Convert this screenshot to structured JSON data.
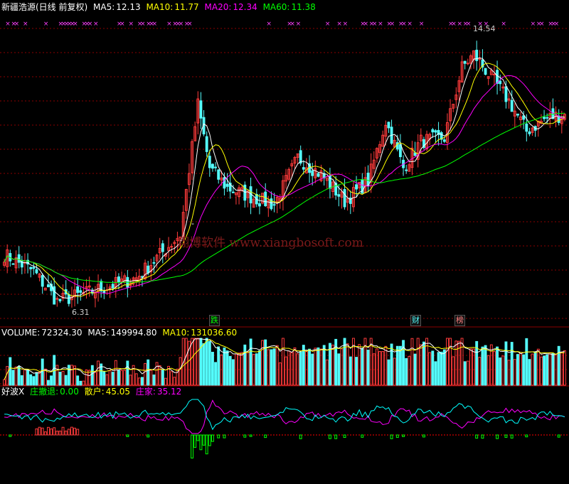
{
  "header": {
    "title": "新疆浩源(日线 前复权)",
    "ma5": {
      "label": "MA5:",
      "value": "12.13"
    },
    "ma10": {
      "label": "MA10:",
      "value": "11.77"
    },
    "ma20": {
      "label": "MA20:",
      "value": "12.34"
    },
    "ma60": {
      "label": "MA60:",
      "value": "11.38"
    }
  },
  "volume_header": {
    "volume": {
      "label": "VOLUME:",
      "value": "72324.30"
    },
    "ma5": {
      "label": "MA5:",
      "value": "149994.80"
    },
    "ma10": {
      "label": "MA10:",
      "value": "131036.60"
    }
  },
  "indicator_header": {
    "name": "好波X",
    "zhuang_withdraw": {
      "label": "庄撤退:",
      "value": "0.00"
    },
    "retail": {
      "label": "散户:",
      "value": "45.05"
    },
    "dealer": {
      "label": "庄家:",
      "value": "35.12"
    }
  },
  "annotations": {
    "high": "14.54",
    "low": "6.31",
    "dash": "-",
    "event_fall": "跌",
    "event_finance": "财",
    "event_list": "榜",
    "watermark": "翔博软件 www.xiangbosoft.com"
  },
  "colors": {
    "up": "#ff3b3b",
    "down": "#54fcfc",
    "ma5": "#ffffff",
    "ma10": "#ffff00",
    "ma20": "#ff00ff",
    "ma60": "#00ff00",
    "grid": "#8b0000",
    "marker": "#ff40ff",
    "retail": "#ff00ff",
    "dealer": "#00ffff",
    "withdraw": "#00ff00"
  },
  "chart_data": {
    "type": "candlestick",
    "symbol": "新疆浩源",
    "period": "daily",
    "price_range": [
      6.0,
      15.2
    ],
    "high_label": 14.54,
    "low_label": 6.31,
    "close_keypoints": [
      {
        "i": 0,
        "c": 8.0
      },
      {
        "i": 10,
        "c": 7.5
      },
      {
        "i": 18,
        "c": 6.6
      },
      {
        "i": 30,
        "c": 6.9
      },
      {
        "i": 45,
        "c": 7.3
      },
      {
        "i": 60,
        "c": 8.6
      },
      {
        "i": 66,
        "c": 12.5
      },
      {
        "i": 70,
        "c": 10.6
      },
      {
        "i": 76,
        "c": 10.0
      },
      {
        "i": 85,
        "c": 9.7
      },
      {
        "i": 92,
        "c": 9.5
      },
      {
        "i": 100,
        "c": 10.9
      },
      {
        "i": 108,
        "c": 10.4
      },
      {
        "i": 116,
        "c": 9.6
      },
      {
        "i": 124,
        "c": 10.2
      },
      {
        "i": 130,
        "c": 12.0
      },
      {
        "i": 136,
        "c": 10.6
      },
      {
        "i": 142,
        "c": 11.4
      },
      {
        "i": 150,
        "c": 11.5
      },
      {
        "i": 156,
        "c": 13.6
      },
      {
        "i": 160,
        "c": 14.0
      },
      {
        "i": 166,
        "c": 13.3
      },
      {
        "i": 172,
        "c": 12.6
      },
      {
        "i": 178,
        "c": 11.7
      },
      {
        "i": 185,
        "c": 12.1
      },
      {
        "i": 191,
        "c": 12.2
      }
    ],
    "moving_averages": [
      {
        "name": "MA5",
        "last": 12.13
      },
      {
        "name": "MA10",
        "last": 11.77
      },
      {
        "name": "MA20",
        "last": 12.34
      },
      {
        "name": "MA60",
        "last": 11.38
      }
    ],
    "volume": {
      "last": 72324.3,
      "ma5": 149994.8,
      "ma10": 131036.6
    },
    "indicator": {
      "name": "好波X",
      "zhuang_withdraw": 0.0,
      "retail": 45.05,
      "dealer": 35.12
    }
  }
}
